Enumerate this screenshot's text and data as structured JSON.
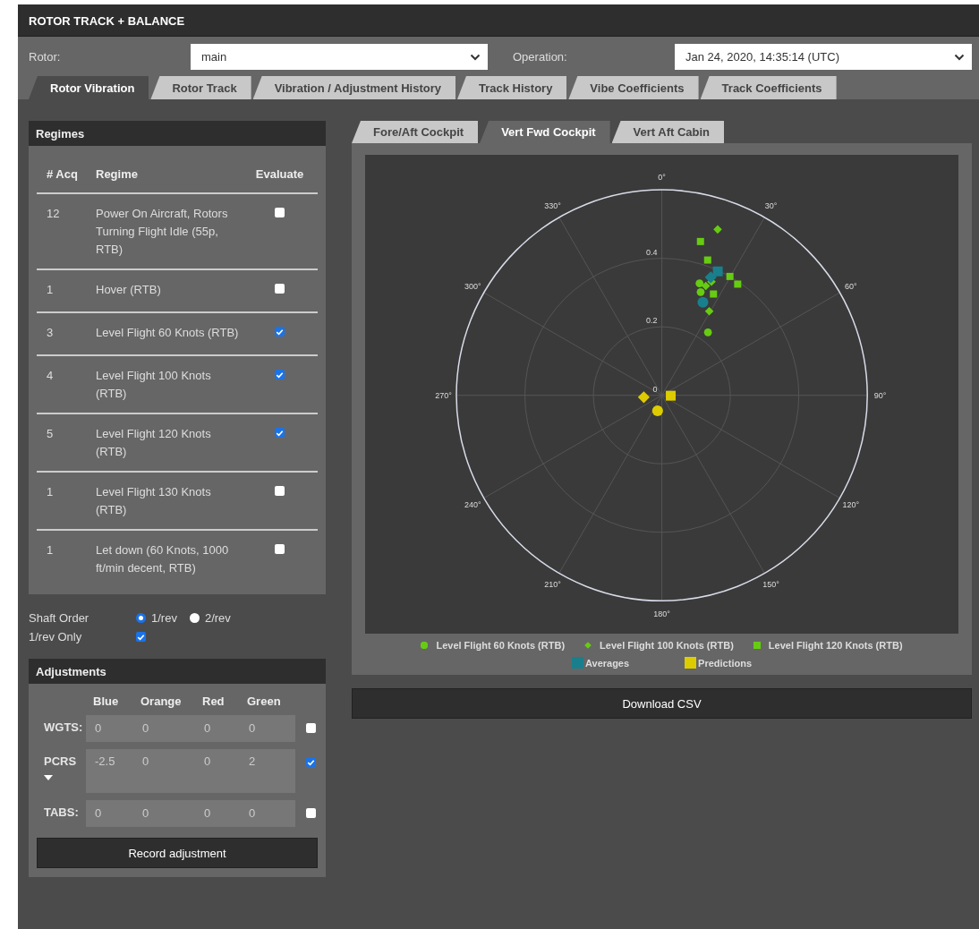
{
  "app": {
    "title": "ROTOR TRACK + BALANCE"
  },
  "selectors": [
    {
      "label": "Rotor:",
      "value": "main"
    },
    {
      "label": "Operation:",
      "value": "Jan 24, 2020, 14:35:14 (UTC)"
    }
  ],
  "tabs": [
    {
      "label": "Rotor Vibration",
      "selected": true
    },
    {
      "label": "Rotor Track",
      "selected": false
    },
    {
      "label": "Vibration / Adjustment History",
      "selected": false
    },
    {
      "label": "Track History",
      "selected": false
    },
    {
      "label": "Vibe Coefficients",
      "selected": false
    },
    {
      "label": "Track Coefficients",
      "selected": false
    }
  ],
  "regimes": {
    "title": "Regimes",
    "columns": [
      "# Acq",
      "Regime",
      "Evaluate"
    ],
    "rows": [
      {
        "acq": "12",
        "regime": "Power On Aircraft, Rotors Turning Flight Idle (55p, RTB)",
        "evaluate": false
      },
      {
        "acq": "1",
        "regime": "Hover (RTB)",
        "evaluate": false
      },
      {
        "acq": "3",
        "regime": "Level Flight 60 Knots (RTB)",
        "evaluate": true
      },
      {
        "acq": "4",
        "regime": "Level Flight 100 Knots (RTB)",
        "evaluate": true
      },
      {
        "acq": "5",
        "regime": "Level Flight 120 Knots (RTB)",
        "evaluate": true
      },
      {
        "acq": "1",
        "regime": "Level Flight 130 Knots (RTB)",
        "evaluate": false
      },
      {
        "acq": "1",
        "regime": "Let down (60 Knots, 1000 ft/min decent, RTB)",
        "evaluate": false
      }
    ]
  },
  "shaft_order": {
    "label": "Shaft Order",
    "options": [
      {
        "label": "1/rev",
        "selected": true
      },
      {
        "label": "2/rev",
        "selected": false
      }
    ]
  },
  "one_rev_only": {
    "label": "1/rev Only",
    "checked": true
  },
  "adjustments": {
    "title": "Adjustments",
    "columns": [
      "Blue",
      "Orange",
      "Red",
      "Green"
    ],
    "rows": [
      {
        "label": "WGTS:",
        "kind": "plain",
        "values": [
          "0",
          "0",
          "0",
          "0"
        ],
        "checked": false
      },
      {
        "label": "PCRS",
        "kind": "dropdown",
        "values": [
          "-2.5",
          "0",
          "0",
          "2"
        ],
        "checked": true
      },
      {
        "label": "TABS:",
        "kind": "plain",
        "values": [
          "0",
          "0",
          "0",
          "0"
        ],
        "checked": false
      }
    ],
    "button": "Record adjustment"
  },
  "chart_tabs": [
    {
      "label": "Fore/Aft Cockpit",
      "selected": false
    },
    {
      "label": "Vert Fwd Cockpit",
      "selected": true
    },
    {
      "label": "Vert Aft Cabin",
      "selected": false
    }
  ],
  "chart": {
    "angle_labels": [
      "0°",
      "30°",
      "60°",
      "90°",
      "120°",
      "150°",
      "180°",
      "210°",
      "240°",
      "270°",
      "300°",
      "330°"
    ],
    "radius_labels": [
      "0.4",
      "0.2",
      "0"
    ],
    "legend": [
      {
        "label": "Level Flight 60 Knots (RTB)",
        "color": "#66cc11",
        "kind": "circle"
      },
      {
        "label": "Level Flight 100 Knots (RTB)",
        "color": "#66cc11",
        "kind": "diamond"
      },
      {
        "label": "Level Flight 120 Knots (RTB)",
        "color": "#66cc11",
        "kind": "square"
      },
      {
        "label": "Averages",
        "color": "#1a7f8c",
        "kind": "mixed"
      },
      {
        "label": "Predictions",
        "color": "#ddcc00",
        "kind": "mixed"
      }
    ]
  },
  "download_button": "Download CSV"
}
